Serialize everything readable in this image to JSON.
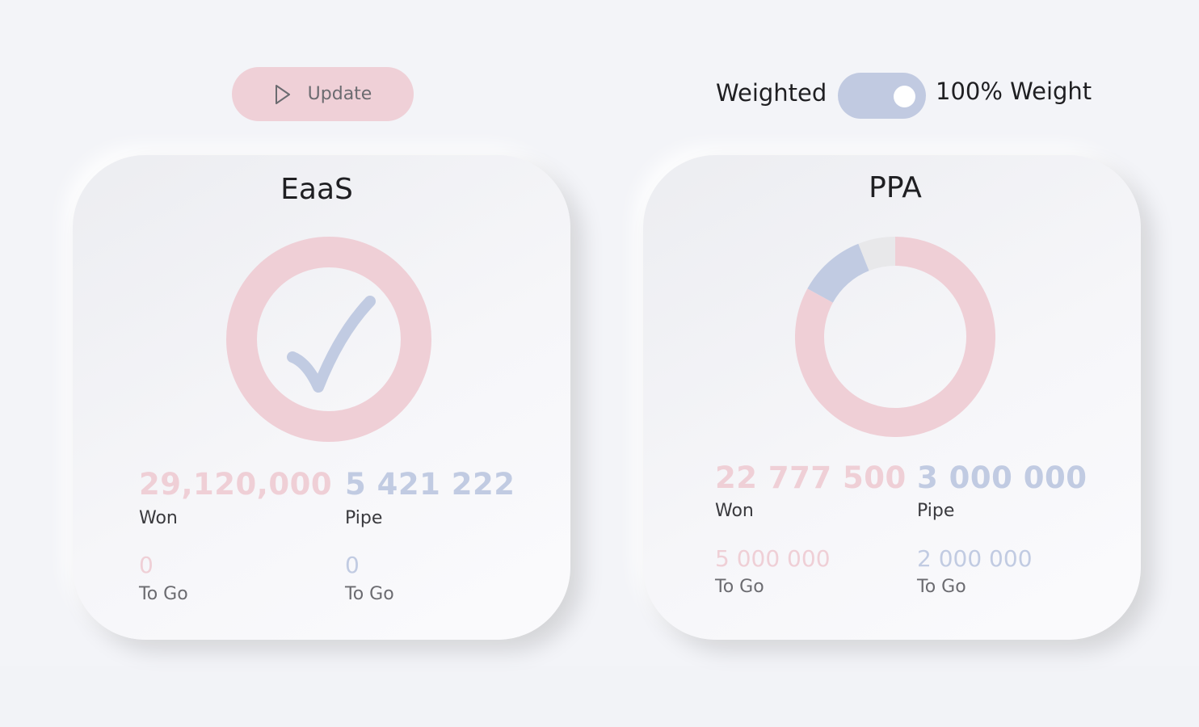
{
  "toolbar": {
    "update_label": "Update",
    "update_icon": "play-icon"
  },
  "weight_toggle": {
    "left_label": "Weighted",
    "right_label": "100% Weight",
    "state": "on"
  },
  "colors": {
    "pink": "#efcfd6",
    "blue": "#c1cbe2",
    "grey": "#e8e8ea",
    "update_button": "#efd0d7",
    "toggle_track": "#c1cae1"
  },
  "cards": {
    "eaas": {
      "title": "EaaS",
      "status_icon": "checkmark-icon",
      "won_value": "29,120,000",
      "won_label": "Won",
      "pipe_value": "5 421 222",
      "pipe_label": "Pipe",
      "won_togo_value": "0",
      "won_togo_label": "To Go",
      "pipe_togo_value": "0",
      "pipe_togo_label": "To Go",
      "donut": [
        {
          "name": "Won",
          "share": 1.0,
          "color": "#efcfd6"
        }
      ]
    },
    "ppa": {
      "title": "PPA",
      "won_value": "22 777 500",
      "won_label": "Won",
      "pipe_value": "3 000 000",
      "pipe_label": "Pipe",
      "won_togo_value": "5 000 000",
      "won_togo_label": "To Go",
      "pipe_togo_value": "2 000 000",
      "pipe_togo_label": "To Go",
      "donut": [
        {
          "name": "Won",
          "share": 0.83,
          "color": "#efcfd6"
        },
        {
          "name": "Pipe",
          "share": 0.11,
          "color": "#c1cbe2"
        },
        {
          "name": "Remaining",
          "share": 0.06,
          "color": "#e8e8ea"
        }
      ]
    }
  }
}
